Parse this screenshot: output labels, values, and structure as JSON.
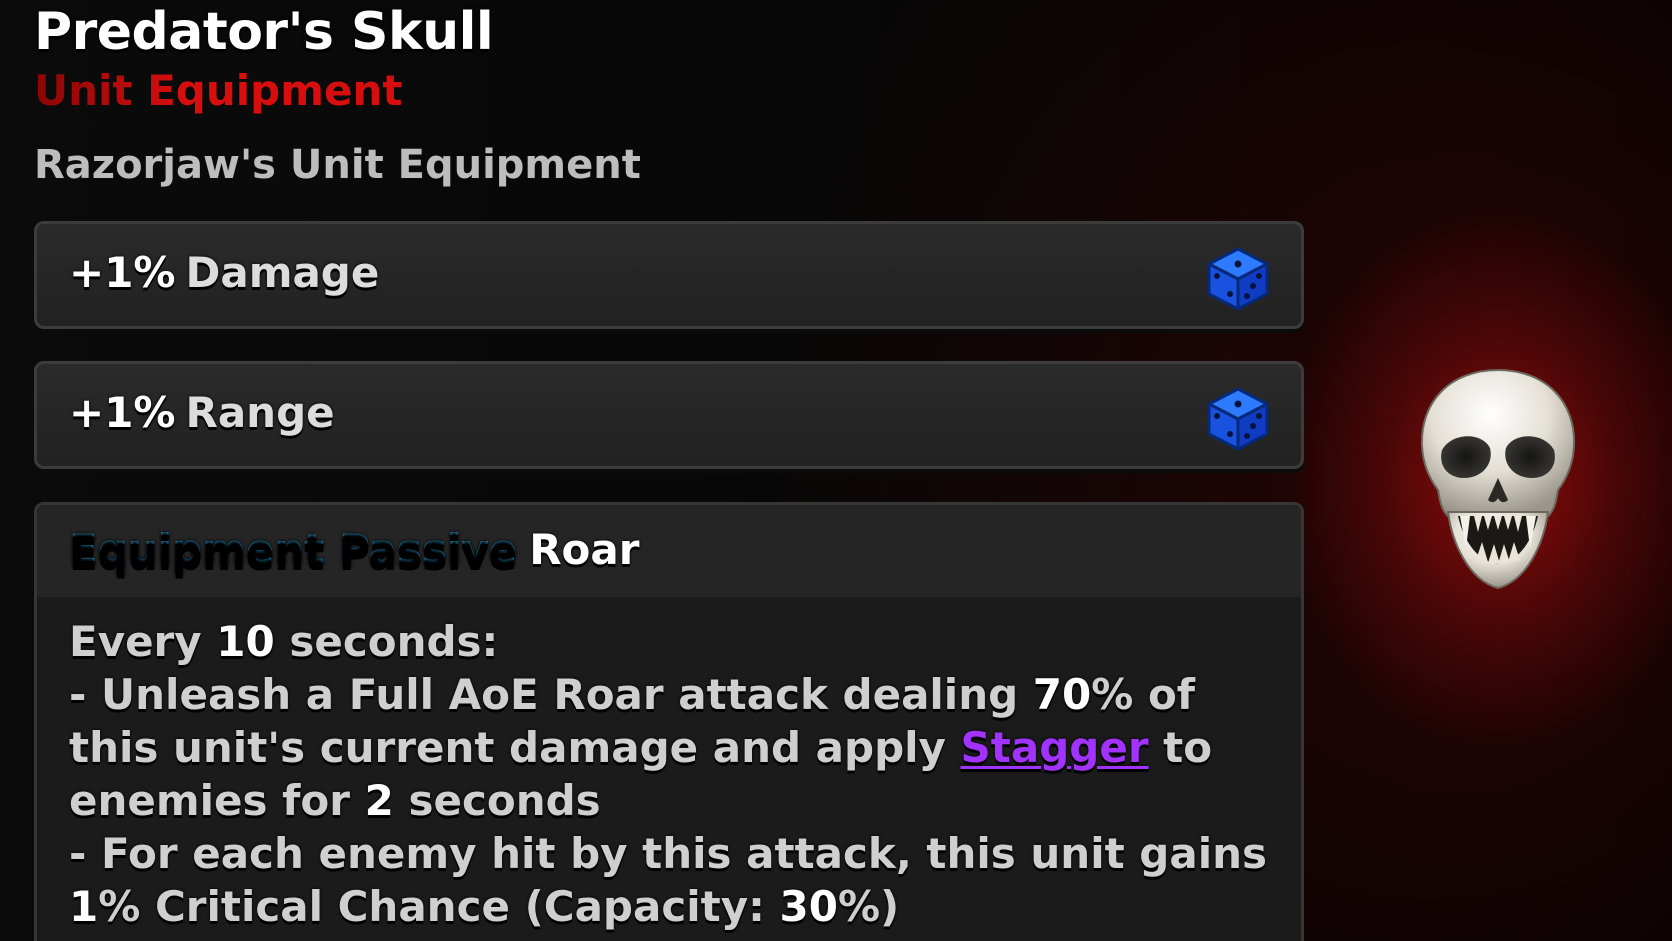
{
  "item": {
    "name": "Predator's Skull",
    "type": "Unit Equipment",
    "owner": "Razorjaw's Unit Equipment"
  },
  "stats": [
    {
      "value": "+1%",
      "label": "Damage",
      "icon": "dice-icon"
    },
    {
      "value": "+1%",
      "label": "Range",
      "icon": "dice-icon"
    }
  ],
  "passive": {
    "label": "Equipment Passive",
    "name": "Roar",
    "line1_pre": "Every",
    "line1_num": "10",
    "line1_post": "seconds:",
    "line2_pre": "- Unleash a Full AoE Roar attack dealing",
    "line2_num": "70",
    "line2_post": "% of",
    "line3_pre": "this unit's current damage and apply",
    "line3_kw": "Stagger",
    "line3_post": "to",
    "line4_pre": "enemies for",
    "line4_num": "2",
    "line4_post": "seconds",
    "line5": "- For each enemy hit by this attack, this unit gains",
    "line6_num": "1",
    "line6_mid": "% Critical Chance (Capacity:",
    "line6_cap": "30",
    "line6_post": "%)"
  },
  "colors": {
    "type_red": "#d80e0e",
    "passive_blue": "#1fb0f2",
    "keyword_purple": "#a233ff",
    "dice_blue": "#1457f0",
    "glow_red": "#960c0c"
  },
  "icons": {
    "dice": "dice-icon",
    "skull": "skull-icon"
  }
}
